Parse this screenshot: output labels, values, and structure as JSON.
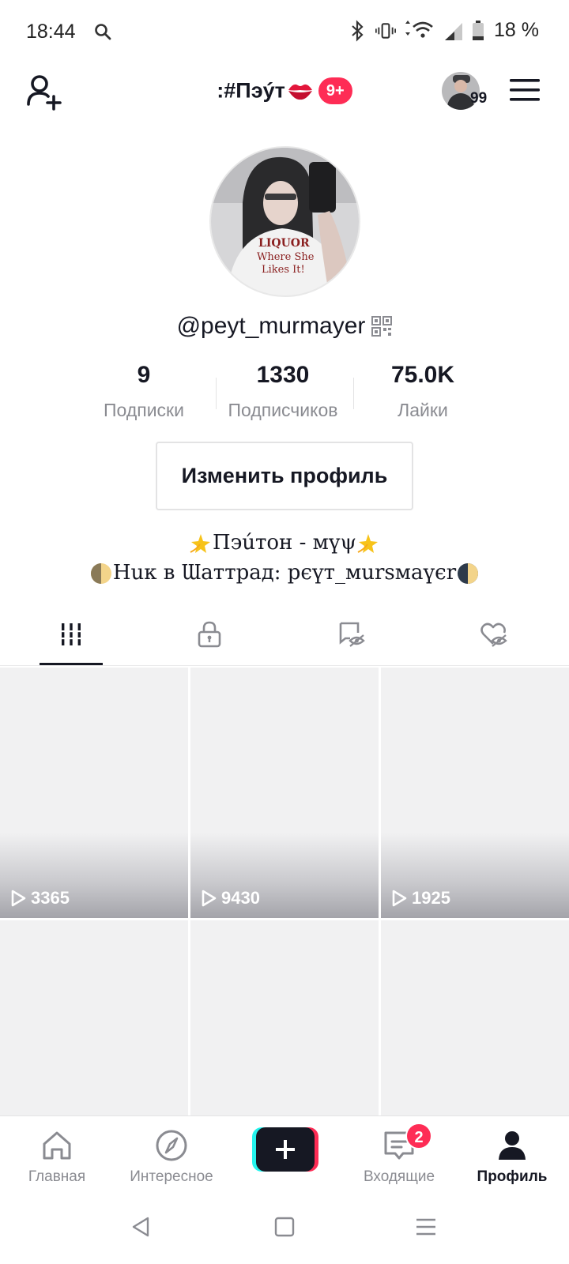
{
  "status_bar": {
    "time": "18:44",
    "battery": "18 %"
  },
  "header": {
    "title": ":#Пэýт",
    "notifications_badge": "9+",
    "switch_account_count": "99"
  },
  "profile": {
    "username": "@peyt_murmayer",
    "stats": [
      {
        "value": "9",
        "label": "Подписки"
      },
      {
        "value": "1330",
        "label": "Подписчиков"
      },
      {
        "value": "75.0K",
        "label": "Лайки"
      }
    ],
    "edit_button": "Изменить профиль",
    "bio_line1": "Пэúтон -  мүψ",
    "bio_line2": "Нuк в Ɯаттрад: рєүт_мursмaүєr"
  },
  "tabs": [
    {
      "icon": "grid-icon",
      "active": true
    },
    {
      "icon": "lock-icon",
      "active": false
    },
    {
      "icon": "tagged-hidden-icon",
      "active": false
    },
    {
      "icon": "liked-hidden-icon",
      "active": false
    }
  ],
  "videos": [
    {
      "views": "3365"
    },
    {
      "views": "9430"
    },
    {
      "views": "1925"
    },
    {
      "views": ""
    },
    {
      "views": ""
    },
    {
      "views": ""
    }
  ],
  "bottom_nav": {
    "home": "Главная",
    "discover": "Интересное",
    "inbox": "Входящие",
    "inbox_badge": "2",
    "profile": "Профиль"
  },
  "colors": {
    "accent": "#fe2c55",
    "text": "#161823",
    "muted": "#8a8b91"
  }
}
